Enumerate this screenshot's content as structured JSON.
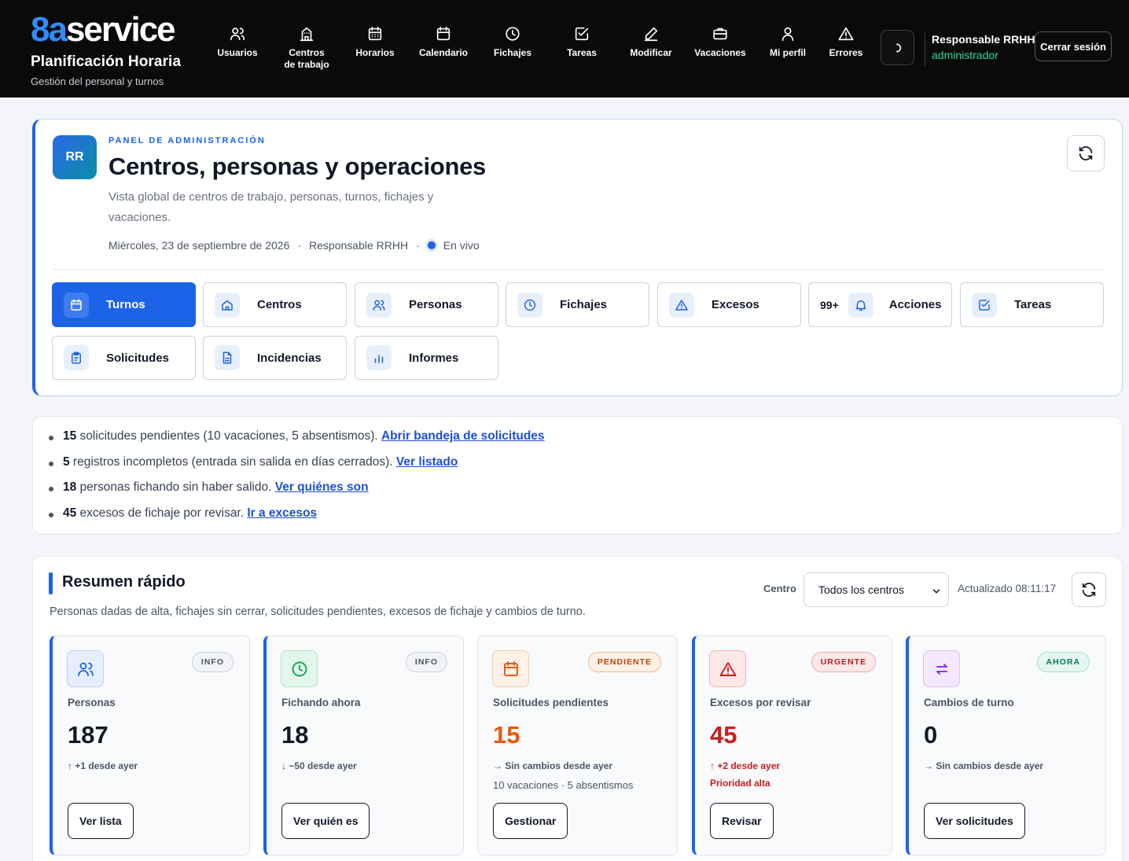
{
  "brand": {
    "logo_prefix": "8a",
    "logo_suffix": "service",
    "title": "Planificación Horaria",
    "subtitle": "Gestión del personal y turnos"
  },
  "nav": [
    {
      "label": "Usuarios",
      "icon": "users-icon"
    },
    {
      "label": "Centros de trabajo",
      "icon": "building-icon"
    },
    {
      "label": "Horarios",
      "icon": "calendar-grid-icon"
    },
    {
      "label": "Calendario",
      "icon": "calendar-icon"
    },
    {
      "label": "Fichajes",
      "icon": "clock-icon"
    },
    {
      "label": "Tareas",
      "icon": "check-square-icon"
    },
    {
      "label": "Modificar",
      "icon": "pencil-icon"
    },
    {
      "label": "Vacaciones",
      "icon": "briefcase-icon"
    },
    {
      "label": "Mi perfil",
      "icon": "user-icon"
    },
    {
      "label": "Errores",
      "icon": "warning-icon"
    }
  ],
  "user": {
    "name": "Responsable RRHH",
    "role": "administrador",
    "logout_label": "Cerrar sesión"
  },
  "panel": {
    "avatar": "RR",
    "eyebrow": "PANEL DE ADMINISTRACIÓN",
    "title": "Centros, personas y operaciones",
    "description": "Vista global de centros de trabajo, personas, turnos, fichajes y vacaciones.",
    "date": "Miércoles, 23 de septiembre de 2026",
    "separator": "·",
    "responsible": "Responsable RRHH",
    "live": "En vivo",
    "tiles": [
      {
        "label": "Turnos",
        "icon": "calendar-icon"
      },
      {
        "label": "Centros",
        "icon": "home-icon"
      },
      {
        "label": "Personas",
        "icon": "users-icon"
      },
      {
        "label": "Fichajes",
        "icon": "clock-icon"
      },
      {
        "label": "Excesos",
        "icon": "warning-icon"
      },
      {
        "label": "Acciones",
        "icon": "bell-icon",
        "count": "99+"
      },
      {
        "label": "Tareas",
        "icon": "check-square-icon"
      },
      {
        "label": "Solicitudes",
        "icon": "clipboard-icon"
      },
      {
        "label": "Incidencias",
        "icon": "document-icon"
      },
      {
        "label": "Informes",
        "icon": "bar-chart-icon"
      }
    ]
  },
  "alerts": [
    {
      "count": "15",
      "text": " solicitudes pendientes (10 vacaciones, 5 absentismos). ",
      "link": "Abrir bandeja de solicitudes"
    },
    {
      "count": "5",
      "text": " registros incompletos (entrada sin salida en días cerrados). ",
      "link": "Ver listado"
    },
    {
      "count": "18",
      "text": " personas fichando sin haber salido. ",
      "link": "Ver quiénes son"
    },
    {
      "count": "45",
      "text": " excesos de fichaje por revisar. ",
      "link": "Ir a excesos"
    }
  ],
  "summary": {
    "title": "Resumen rápido",
    "description": "Personas dadas de alta, fichajes sin cerrar, solicitudes pendientes, excesos de fichaje y cambios de turno.",
    "centro_label": "Centro",
    "centro_value": "Todos los centros",
    "updated": "Actualizado 08:11:17",
    "cards": [
      {
        "label": "Personas",
        "value": "187",
        "pill": "INFO",
        "trend": "↑ +1 desde ayer",
        "extra": "",
        "button": "Ver lista",
        "icon": "users-icon",
        "accent": "#1d63e8"
      },
      {
        "label": "Fichando ahora",
        "value": "18",
        "pill": "INFO",
        "trend": "↓ −50 desde ayer",
        "extra": "",
        "button": "Ver quién es",
        "icon": "clock-icon",
        "accent": "#1d63e8"
      },
      {
        "label": "Solicitudes pendientes",
        "value": "15",
        "pill": "PENDIENTE",
        "trend": "→ Sin cambios desde ayer",
        "extra": "10 vacaciones · 5 absentismos",
        "button": "Gestionar",
        "icon": "calendar-icon",
        "accent": "#d1d5db"
      },
      {
        "label": "Excesos por revisar",
        "value": "45",
        "pill": "URGENTE",
        "trend": "↑ +2 desde ayer",
        "extra": "Prioridad alta",
        "button": "Revisar",
        "icon": "warning-icon",
        "accent": "#1d63e8"
      },
      {
        "label": "Cambios de turno",
        "value": "0",
        "pill": "AHORA",
        "trend": "→ Sin cambios desde ayer",
        "extra": "",
        "button": "Ver solicitudes",
        "icon": "swap-icon",
        "accent": "#1d63e8"
      }
    ]
  },
  "colors": {
    "primary": "#1d63e8",
    "topbar": "#0a0a0b",
    "role": "#2dd4a6",
    "pending": "#ea580c",
    "urgent": "#c81e1e",
    "ahora": "#059669"
  }
}
